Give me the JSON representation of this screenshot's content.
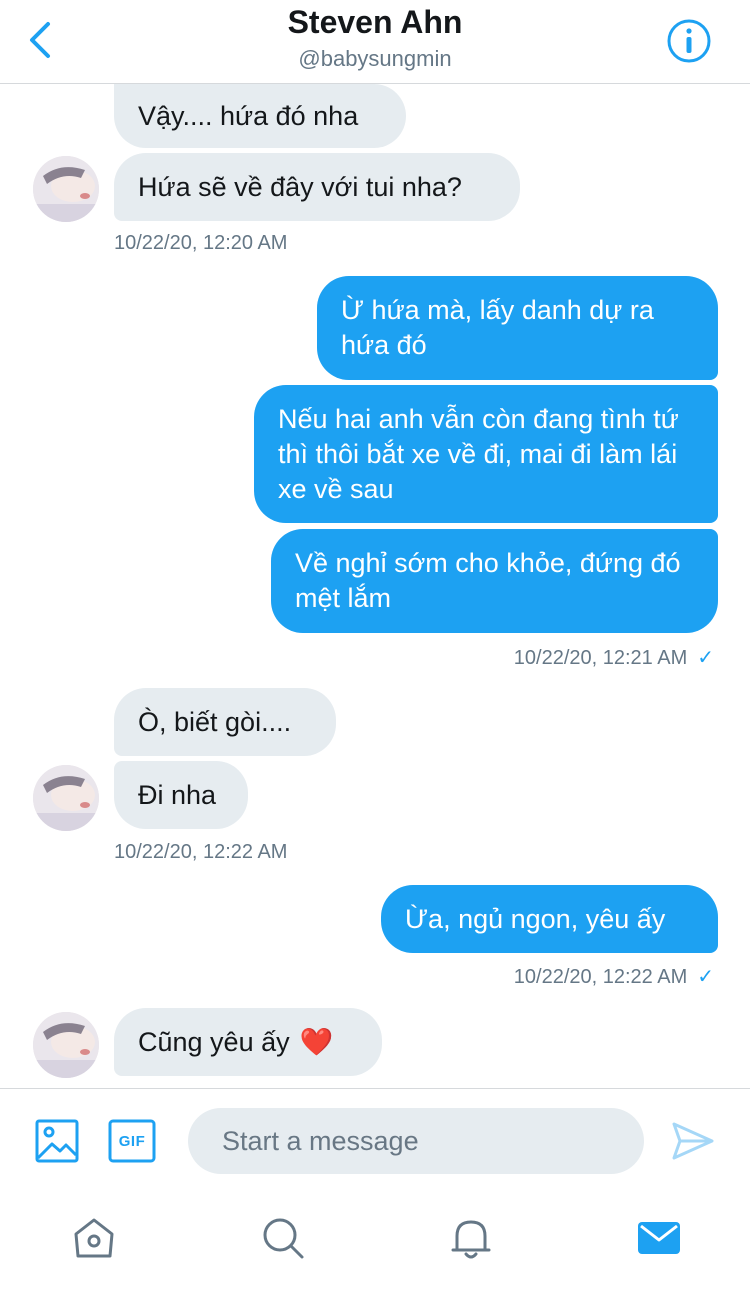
{
  "header": {
    "name": "Steven Ahn",
    "handle": "@babysungmin",
    "back_icon": "chevron-left-icon",
    "info_icon": "info-circle-icon"
  },
  "messages": [
    {
      "direction": "in",
      "text": "Vậy.... hứa đó nha"
    },
    {
      "direction": "in",
      "text": "Hứa sẽ về đây với tui nha?"
    },
    {
      "direction": "out",
      "text": "Ừ hứa mà, lấy danh dự ra hứa đó"
    },
    {
      "direction": "out",
      "text": "Nếu hai anh vẫn còn đang tình tứ thì thôi bắt xe về đi, mai đi làm lái xe về sau"
    },
    {
      "direction": "out",
      "text": "Về nghỉ sớm cho khỏe, đứng đó mệt lắm"
    },
    {
      "direction": "in",
      "text": "Ò, biết gòi...."
    },
    {
      "direction": "in",
      "text": "Đi nha"
    },
    {
      "direction": "out",
      "text": "Ừa, ngủ ngon, yêu ấy"
    },
    {
      "direction": "in",
      "text": "Cũng yêu ấy",
      "emoji": "❤️"
    }
  ],
  "timestamps": [
    {
      "text": "10/22/20, 12:20 AM",
      "direction": "in"
    },
    {
      "text": "10/22/20, 12:21 AM",
      "direction": "out",
      "check": "✓"
    },
    {
      "text": "10/22/20, 12:22 AM",
      "direction": "in"
    },
    {
      "text": "10/22/20, 12:22 AM",
      "direction": "out",
      "check": "✓"
    }
  ],
  "composer": {
    "placeholder": "Start a message",
    "image_icon": "image-icon",
    "gif_label": "GIF",
    "send_icon": "send-icon"
  },
  "tabs": [
    {
      "name": "home-icon",
      "active": false
    },
    {
      "name": "search-icon",
      "active": false
    },
    {
      "name": "notifications-icon",
      "active": false
    },
    {
      "name": "messages-icon",
      "active": true
    }
  ],
  "colors": {
    "accent": "#1da1f2",
    "incoming_bubble": "#e6ecf0",
    "secondary_text": "#657786"
  }
}
